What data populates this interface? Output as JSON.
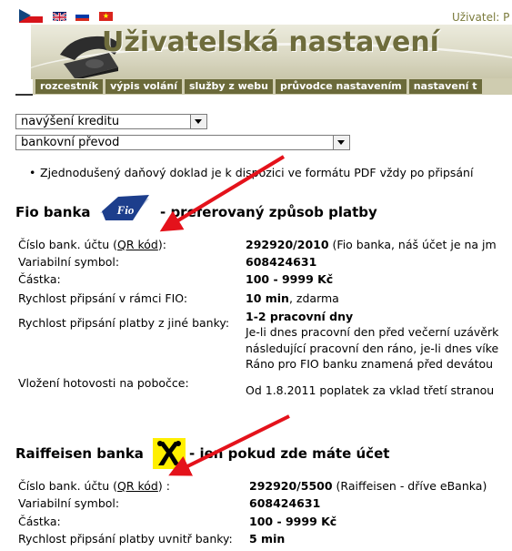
{
  "header": {
    "user_label": "Uživatel: P",
    "banner_title": "Uživatelská nastavení",
    "flags": [
      "flag-cz",
      "flag-gb",
      "flag-ru",
      "flag-vn"
    ]
  },
  "nav": {
    "tabs": [
      "rozcestník",
      "výpis volání",
      "služby z webu",
      "průvodce nastavením",
      "nastavení t"
    ]
  },
  "form": {
    "select_credit": "navýšení kreditu",
    "select_method": "bankovní převod"
  },
  "bullet": "Zjednodušený daňový doklad je k dispozici ve formátu PDF vždy po připsání",
  "fio": {
    "title": "Fio banka",
    "logo_text": "Fio",
    "suffix": "- preferovaný způsob platby",
    "rows": {
      "account_label_pre": "Číslo bank. účtu (",
      "account_label_link": "QR kód",
      "account_label_post": "):",
      "account_value": "292920/2010",
      "account_note": "(Fio banka, náš účet je na jm",
      "vs_label": "Variabilní symbol:",
      "vs_value": "608424631",
      "amount_label": "Částka:",
      "amount_value": "100 - 9999 Kč",
      "speed_fio_label": "Rychlost připsání v rámci FIO:",
      "speed_fio_value": "10 min",
      "speed_fio_note": ", zdarma",
      "speed_other_label": "Rychlost připsání platby z jiné banky:",
      "speed_other_value": "1-2 pracovní dny",
      "speed_other_line1": "Je-li dnes pracovní den před večerní uzávěrk",
      "speed_other_line2": "následující pracovní den ráno, je-li dnes víke",
      "speed_other_line3": "Ráno pro FIO banku znamená před devátou",
      "cash_label": "Vložení hotovosti na pobočce:",
      "cash_value": "Od 1.8.2011 poplatek za vklad třetí stranou"
    }
  },
  "raiffeisen": {
    "title": "Raiffeisen banka",
    "suffix": "- jen pokud zde máte účet",
    "rows": {
      "account_label_pre": "Číslo bank. účtu (",
      "account_label_link": "QR kód",
      "account_label_post": ") :",
      "account_value": "292920/5500",
      "account_note": "(Raiffeisen - dříve eBanka)",
      "vs_label": "Variabilní symbol:",
      "vs_value": "608424631",
      "amount_label": "Částka:",
      "amount_value": "100 - 9999 Kč",
      "speed_label": "Rychlost připsání platby uvnitř banky:",
      "speed_value": "5 min"
    }
  },
  "colors": {
    "nav_tab": "#6b6a3a",
    "banner_title": "#6e6c3c",
    "arrow": "#e4121b",
    "fio_blue": "#1d3e8c",
    "raiffeisen_yellow": "#ffef00"
  }
}
